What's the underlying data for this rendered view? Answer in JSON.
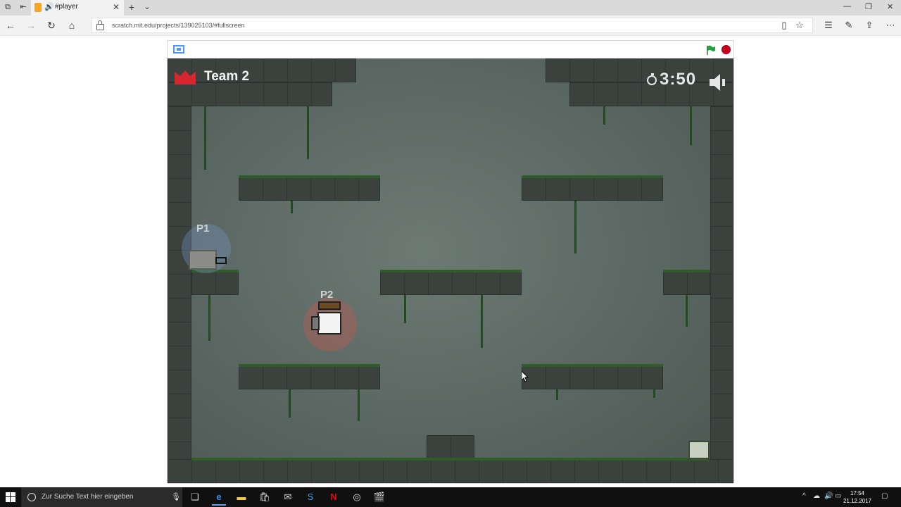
{
  "browser": {
    "tab_title": "#player",
    "tab_close": "✕",
    "new_tab": "+",
    "tab_menu": "⌄",
    "url": "scratch.mit.edu/projects/139025103/#fullscreen",
    "window_controls": [
      "—",
      "❐",
      "✕"
    ]
  },
  "player": {
    "team_label": "Team 2",
    "timer": "3:50",
    "p1_label": "P1",
    "p2_label": "P2",
    "colors": {
      "crown": "#d9252e",
      "flag": "#1fa63b",
      "stop": "#c8001e"
    }
  },
  "taskbar": {
    "search_placeholder": "Zur Suche Text hier eingeben",
    "clock_time": "17:54",
    "clock_date": "21.12.2017"
  }
}
